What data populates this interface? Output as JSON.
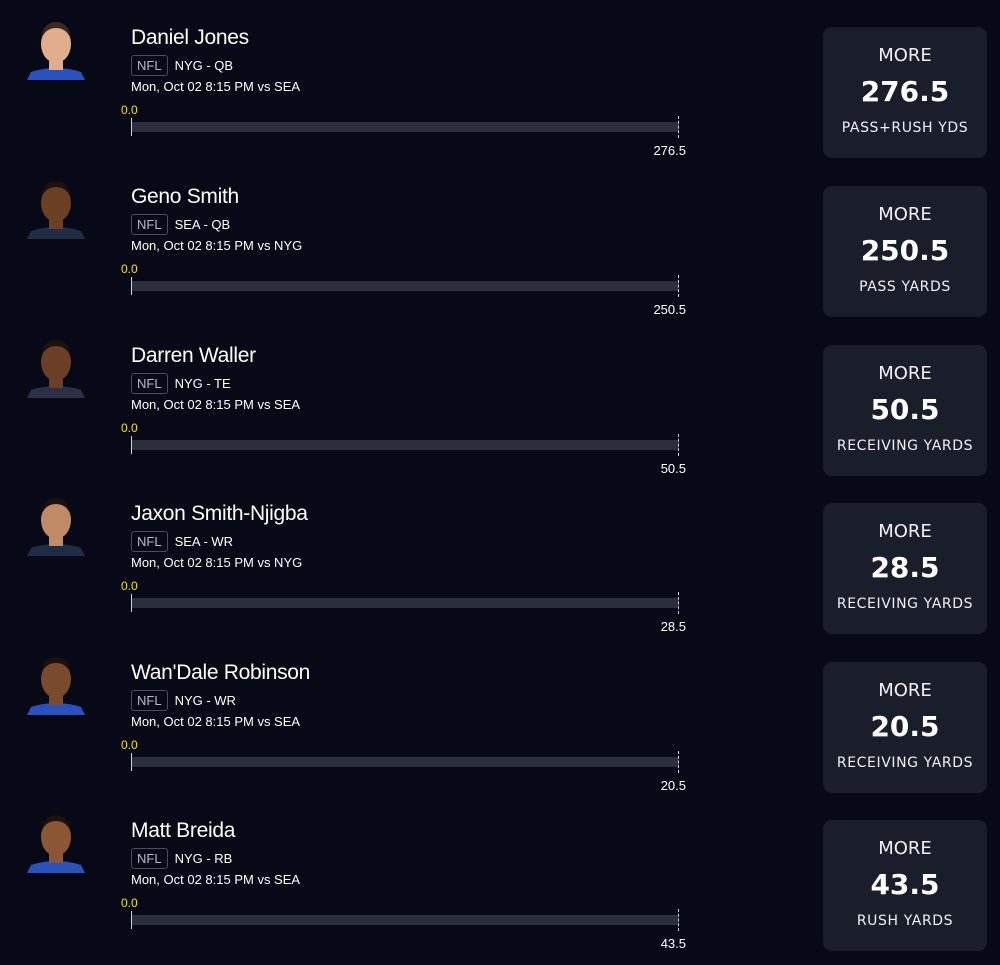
{
  "colors": {
    "background": "#070a16",
    "card": "#1a1d2a",
    "accent": "#f7e600",
    "track": "#2b2e3b"
  },
  "players": [
    {
      "name": "Daniel Jones",
      "league": "NFL",
      "team_pos": "NYG - QB",
      "game": "Mon, Oct 02 8:15 PM  vs SEA",
      "current": "0.0",
      "line": "276.5",
      "direction": "MORE",
      "stat": "PASS+RUSH YDS",
      "progress": 0,
      "jersey_color": "#2a52be",
      "skin": "#e0ae8c",
      "hair": "#3a2a1e"
    },
    {
      "name": "Geno Smith",
      "league": "NFL",
      "team_pos": "SEA - QB",
      "game": "Mon, Oct 02 8:15 PM  vs NYG",
      "current": "0.0",
      "line": "250.5",
      "direction": "MORE",
      "stat": "PASS YARDS",
      "progress": 0,
      "jersey_color": "#1f2d44",
      "skin": "#6b3f24",
      "hair": "#1a120d"
    },
    {
      "name": "Darren Waller",
      "league": "NFL",
      "team_pos": "NYG - TE",
      "game": "Mon, Oct 02 8:15 PM  vs SEA",
      "current": "0.0",
      "line": "50.5",
      "direction": "MORE",
      "stat": "RECEIVING YARDS",
      "progress": 0,
      "jersey_color": "#2a2f46",
      "skin": "#6a3f26",
      "hair": "#1a120d"
    },
    {
      "name": "Jaxon Smith-Njigba",
      "league": "NFL",
      "team_pos": "SEA - WR",
      "game": "Mon, Oct 02 8:15 PM  vs NYG",
      "current": "0.0",
      "line": "28.5",
      "direction": "MORE",
      "stat": "RECEIVING YARDS",
      "progress": 0,
      "jersey_color": "#1f2d44",
      "skin": "#c08a66",
      "hair": "#1a120d"
    },
    {
      "name": "Wan'Dale Robinson",
      "league": "NFL",
      "team_pos": "NYG - WR",
      "game": "Mon, Oct 02 8:15 PM  vs SEA",
      "current": "0.0",
      "line": "20.5",
      "direction": "MORE",
      "stat": "RECEIVING YARDS",
      "progress": 0,
      "jersey_color": "#2a52be",
      "skin": "#7a4a2c",
      "hair": "#1a120d"
    },
    {
      "name": "Matt Breida",
      "league": "NFL",
      "team_pos": "NYG - RB",
      "game": "Mon, Oct 02 8:15 PM  vs SEA",
      "current": "0.0",
      "line": "43.5",
      "direction": "MORE",
      "stat": "RUSH YARDS",
      "progress": 0,
      "jersey_color": "#2a52be",
      "skin": "#8a5634",
      "hair": "#1a120d"
    }
  ]
}
